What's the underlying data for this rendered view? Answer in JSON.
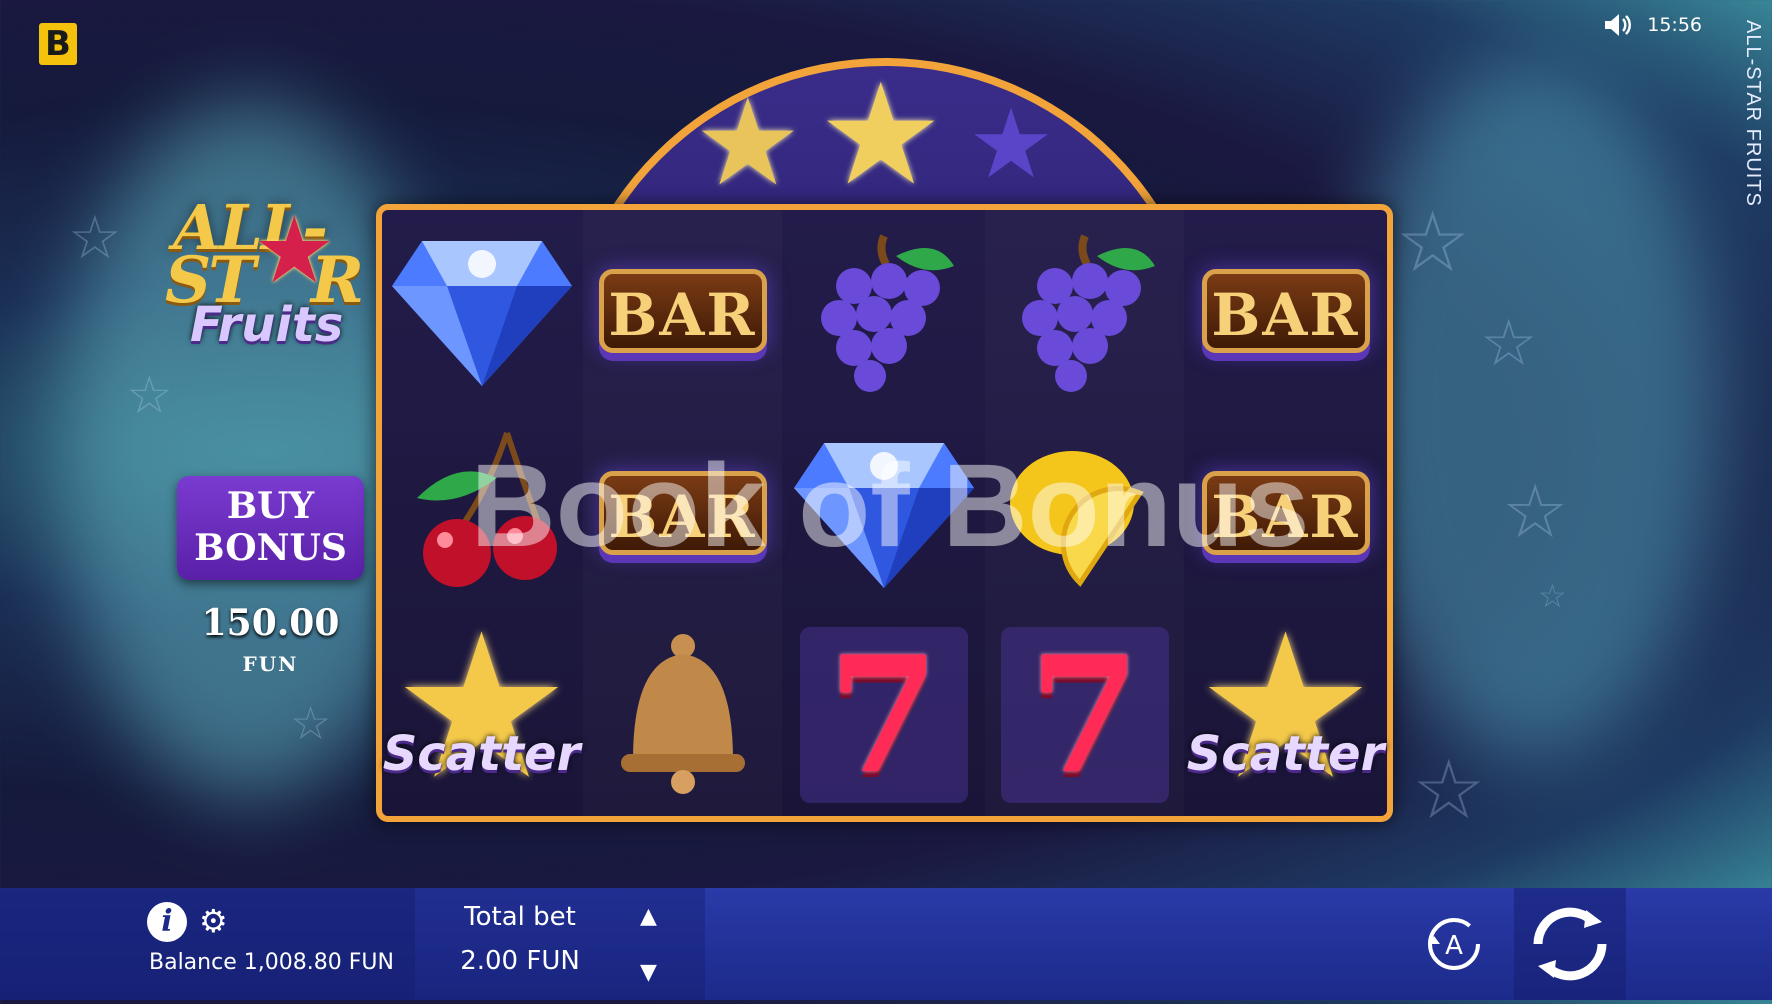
{
  "brand": {
    "logo_letter": "B"
  },
  "status": {
    "time": "15:56",
    "sound_icon": "speaker-icon"
  },
  "game_title_vertical": "ALL-STAR FRUITS",
  "logo": {
    "line1": "ALL-",
    "line2": "ST",
    "line2b": "R",
    "line3": "Fruits"
  },
  "buy_bonus": {
    "label": "BUY\nBONUS",
    "price": "150.00",
    "currency": "FUN"
  },
  "reels": [
    [
      "diamond",
      "cherry",
      "scatter"
    ],
    [
      "bar",
      "bar",
      "bell"
    ],
    [
      "grapes",
      "diamond",
      "seven"
    ],
    [
      "grapes",
      "lemon",
      "seven"
    ],
    [
      "bar",
      "bar",
      "scatter"
    ]
  ],
  "symbol_text": {
    "bar": "BAR",
    "scatter": "Scatter",
    "seven": "7"
  },
  "watermark": "Book of Bonus",
  "bottom_bar": {
    "balance": "Balance 1,008.80 FUN",
    "total_bet_label": "Total bet",
    "total_bet_value": "2.00 FUN",
    "auto_label": "A"
  },
  "colors": {
    "accent_gold": "#f2a33a",
    "bonus_purple": "#6a2ec0",
    "bar_blue": "#2a3aa8"
  }
}
